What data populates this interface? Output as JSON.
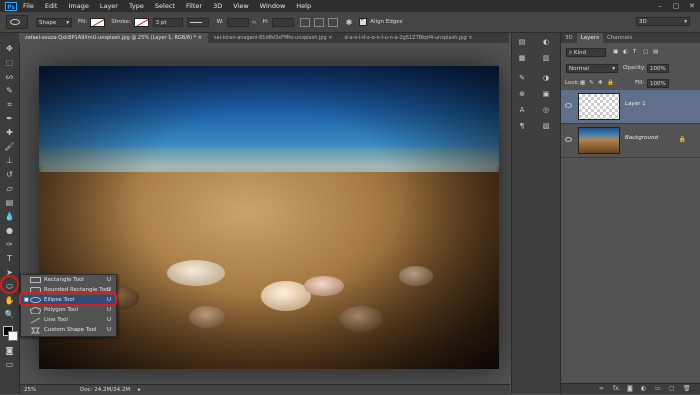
{
  "app": {
    "logo": "Ps"
  },
  "menubar": {
    "items": [
      "File",
      "Edit",
      "Image",
      "Layer",
      "Type",
      "Select",
      "Filter",
      "3D",
      "View",
      "Window",
      "Help"
    ],
    "window_controls": [
      "–",
      "▢",
      "✕"
    ]
  },
  "options_bar": {
    "mode": "Shape",
    "fill_label": "Fill:",
    "stroke_label": "Stroke:",
    "stroke_width": "3 pt",
    "w_label": "W:",
    "h_label": "H:",
    "align_edges_label": "Align Edges",
    "workspace": "3D"
  },
  "tabs": [
    {
      "label": "zafael-souza-QxkBP1A9XmU-unsplash.jpg @ 25% (Layer 1, RGB/8) *",
      "active": true
    },
    {
      "label": "sai-kiran-anagani-81d8d3xFMfo-unsplash.jpg",
      "active": false
    },
    {
      "label": "d-a-v-i-d-s-o-n-l-u-n-a-2gS1Z7Bkpf4-unsplash.jpg",
      "active": false
    }
  ],
  "status": {
    "zoom": "25%",
    "doc": "Doc: 24.2M/24.2M"
  },
  "flyout": {
    "items": [
      {
        "label": "Rectangle Tool",
        "key": "U",
        "icon": "rectangle-icon",
        "selected": false,
        "current": false
      },
      {
        "label": "Rounded Rectangle Tool",
        "key": "U",
        "icon": "rounded-rectangle-icon",
        "selected": false,
        "current": false
      },
      {
        "label": "Ellipse Tool",
        "key": "U",
        "icon": "ellipse-icon",
        "selected": true,
        "current": true
      },
      {
        "label": "Polygon Tool",
        "key": "U",
        "icon": "polygon-icon",
        "selected": false,
        "current": false
      },
      {
        "label": "Line Tool",
        "key": "U",
        "icon": "line-icon",
        "selected": false,
        "current": false
      },
      {
        "label": "Custom Shape Tool",
        "key": "U",
        "icon": "custom-shape-icon",
        "selected": false,
        "current": false
      }
    ]
  },
  "layers_panel": {
    "tabs": [
      {
        "label": "3D",
        "active": false
      },
      {
        "label": "Layers",
        "active": true
      },
      {
        "label": "Channels",
        "active": false
      }
    ],
    "filter_label": "Kind",
    "blend_mode": "Normal",
    "opacity_label": "Opacity:",
    "opacity_value": "100%",
    "lock_label": "Lock:",
    "fill_label": "Fill:",
    "fill_value": "100%",
    "layers": [
      {
        "name": "Layer 1",
        "selected": true,
        "thumbnail": "transparent"
      },
      {
        "name": "Background",
        "selected": false,
        "thumbnail": "photo",
        "locked": true
      }
    ],
    "bottom_icons": [
      "link-icon",
      "fx-icon",
      "mask-icon",
      "adjustment-icon",
      "group-icon",
      "new-layer-icon",
      "trash-icon"
    ],
    "fx_label": "fx."
  },
  "colors": {
    "highlight": "#e01b1b",
    "selection": "#2f4d78",
    "layer_selected": "#5f6f8c"
  }
}
